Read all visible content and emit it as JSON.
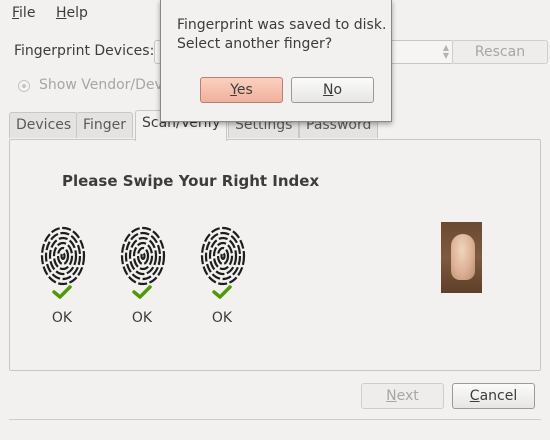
{
  "menubar": {
    "file": {
      "mnemonic": "F",
      "rest": "ile"
    },
    "help": {
      "mnemonic": "H",
      "rest": "elp"
    }
  },
  "devices": {
    "label": "Fingerprint Devices:",
    "selected": "",
    "rescan_label": "Rescan"
  },
  "vendor_option": {
    "label": "Show Vendor/Dev"
  },
  "tabs": [
    {
      "label": "Devices",
      "active": false
    },
    {
      "label": "Finger",
      "active": false
    },
    {
      "label": "Scan/Verify",
      "active": true
    },
    {
      "label": "Settings",
      "active": false
    },
    {
      "label": "Password",
      "active": false
    }
  ],
  "scan": {
    "title": "Please Swipe Your Right Index",
    "results": [
      {
        "status": "OK",
        "icon": "check-icon"
      },
      {
        "status": "OK",
        "icon": "check-icon"
      },
      {
        "status": "OK",
        "icon": "check-icon"
      }
    ]
  },
  "buttons": {
    "next": {
      "mnemonic": "N",
      "rest": "ext"
    },
    "cancel": {
      "mnemonic": "C",
      "rest": "ancel"
    }
  },
  "dialog": {
    "line1": "Fingerprint was saved to disk.",
    "line2": "Select another finger?",
    "yes": {
      "mnemonic": "Y",
      "rest": "es"
    },
    "no": {
      "mnemonic": "N",
      "rest": "o"
    }
  },
  "colors": {
    "window_bg": "#f2f1f0",
    "accent_button": "#f1b19c",
    "check_green": "#4e9a06"
  }
}
